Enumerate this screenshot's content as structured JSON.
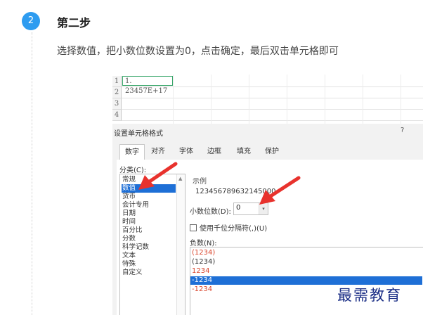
{
  "step": {
    "number": "2",
    "title": "第二步",
    "instruction": "选择数值，把小数位数设置为0，点击确定，最后双击单元格即可"
  },
  "spreadsheet": {
    "rows": [
      "1",
      "2",
      "3",
      "4"
    ],
    "cell_a1": "1. 23457E+17"
  },
  "dialog": {
    "title": "设置单元格格式",
    "help": "?",
    "tabs": [
      "数字",
      "对齐",
      "字体",
      "边框",
      "填充",
      "保护"
    ],
    "active_tab": "数字",
    "category_label": "分类(C):",
    "categories": [
      "常规",
      "数值",
      "货币",
      "会计专用",
      "日期",
      "时间",
      "百分比",
      "分数",
      "科学记数",
      "文本",
      "特殊",
      "自定义"
    ],
    "selected_category": "数值",
    "sample_label": "示例",
    "sample_value": "123456789632145000",
    "decimal_label": "小数位数(D):",
    "decimal_value": "0",
    "thousand_separator_label": "使用千位分隔符(,)(U)",
    "negative_label": "负数(N):",
    "negative_options": [
      {
        "text": "(1234)",
        "color": "#d9442b"
      },
      {
        "text": "(1234)",
        "color": "#333333"
      },
      {
        "text": "1234",
        "color": "#d9442b"
      },
      {
        "text": "-1234",
        "color": "#ffffff"
      },
      {
        "text": "-1234",
        "color": "#d9442b"
      }
    ],
    "selected_negative": "-1234"
  },
  "watermark": "最需教育",
  "colors": {
    "badge": "#2e9cf0",
    "selection": "#1e6fd6",
    "arrow": "#e8322d"
  }
}
